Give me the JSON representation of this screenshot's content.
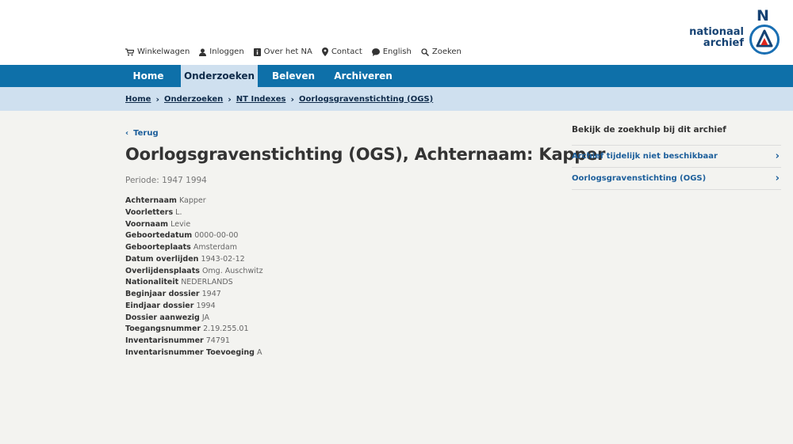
{
  "utility_nav": [
    {
      "label": "Winkelwagen",
      "icon": "cart-icon"
    },
    {
      "label": "Inloggen",
      "icon": "user-icon"
    },
    {
      "label": "Over het NA",
      "icon": "info-icon"
    },
    {
      "label": "Contact",
      "icon": "location-pin-icon"
    },
    {
      "label": "English",
      "icon": "speech-bubble-icon"
    },
    {
      "label": "Zoeken",
      "icon": "search-icon"
    }
  ],
  "logo": {
    "line1": "nationaal",
    "line2": "archief",
    "letter": "N",
    "brand_color": "#154273",
    "accent_color": "#e1261c"
  },
  "main_nav": {
    "items": [
      "Home",
      "Onderzoeken",
      "Beleven",
      "Archiveren"
    ],
    "active": "Onderzoeken",
    "bar_color": "#0e70a9"
  },
  "breadcrumb": [
    "Home",
    "Onderzoeken",
    "NT Indexes",
    "Oorlogsgravenstichting (OGS)"
  ],
  "back_label": "Terug",
  "title": "Oorlogsgravenstichting (OGS), Achternaam: Kapper",
  "periode": "Periode: 1947 1994",
  "details": [
    {
      "label": "Achternaam",
      "value": "Kapper"
    },
    {
      "label": "Voorletters",
      "value": "L."
    },
    {
      "label": "Voornaam",
      "value": "Levie"
    },
    {
      "label": "Geboortedatum",
      "value": "0000-00-00"
    },
    {
      "label": "Geboorteplaats",
      "value": "Amsterdam"
    },
    {
      "label": "Datum overlijden",
      "value": "1943-02-12"
    },
    {
      "label": "Overlijdensplaats",
      "value": "Omg. Auschwitz"
    },
    {
      "label": "Nationaliteit",
      "value": "NEDERLANDS"
    },
    {
      "label": "Beginjaar dossier",
      "value": "1947"
    },
    {
      "label": "Eindjaar dossier",
      "value": "1994"
    },
    {
      "label": "Dossier aanwezig",
      "value": "JA"
    },
    {
      "label": "Toegangsnummer",
      "value": "2.19.255.01"
    },
    {
      "label": "Inventarisnummer",
      "value": "74791"
    },
    {
      "label": "Inventarisnummer Toevoeging",
      "value": "A"
    }
  ],
  "aside": {
    "title": "Bekijk de zoekhulp bij dit archief",
    "links": [
      "Archief tijdelijk niet beschikbaar",
      "Oorlogsgravenstichting (OGS)"
    ]
  }
}
